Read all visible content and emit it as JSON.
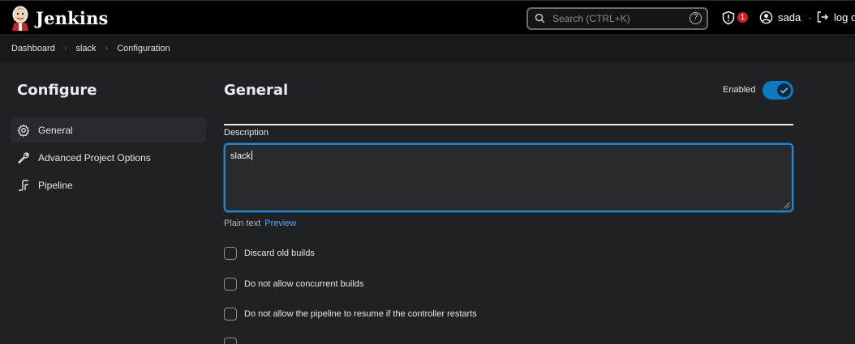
{
  "header": {
    "brand": "Jenkins",
    "search_placeholder": "Search (CTRL+K)",
    "help_glyph": "?",
    "alert_count": "1",
    "user_name": "sada",
    "logout_label": "log o"
  },
  "breadcrumb": [
    "Dashboard",
    "slack",
    "Configuration"
  ],
  "sidebar": {
    "title": "Configure",
    "items": [
      {
        "label": "General",
        "icon": "gear-icon",
        "active": true
      },
      {
        "label": "Advanced Project Options",
        "icon": "wrench-icon",
        "active": false
      },
      {
        "label": "Pipeline",
        "icon": "pipeline-icon",
        "active": false
      }
    ]
  },
  "main": {
    "title": "General",
    "enabled_label": "Enabled",
    "enabled": true,
    "description_label": "Description",
    "description_value": "slack",
    "format_text": "Plain text",
    "preview_link": "Preview",
    "options": [
      {
        "label": "Discard old builds",
        "checked": false
      },
      {
        "label": "Do not allow concurrent builds",
        "checked": false
      },
      {
        "label": "Do not allow the pipeline to resume if the controller restarts",
        "checked": false
      }
    ]
  },
  "colors": {
    "accent": "#0a7bc4",
    "badge": "#d11f2c",
    "link": "#5aa6e6"
  }
}
